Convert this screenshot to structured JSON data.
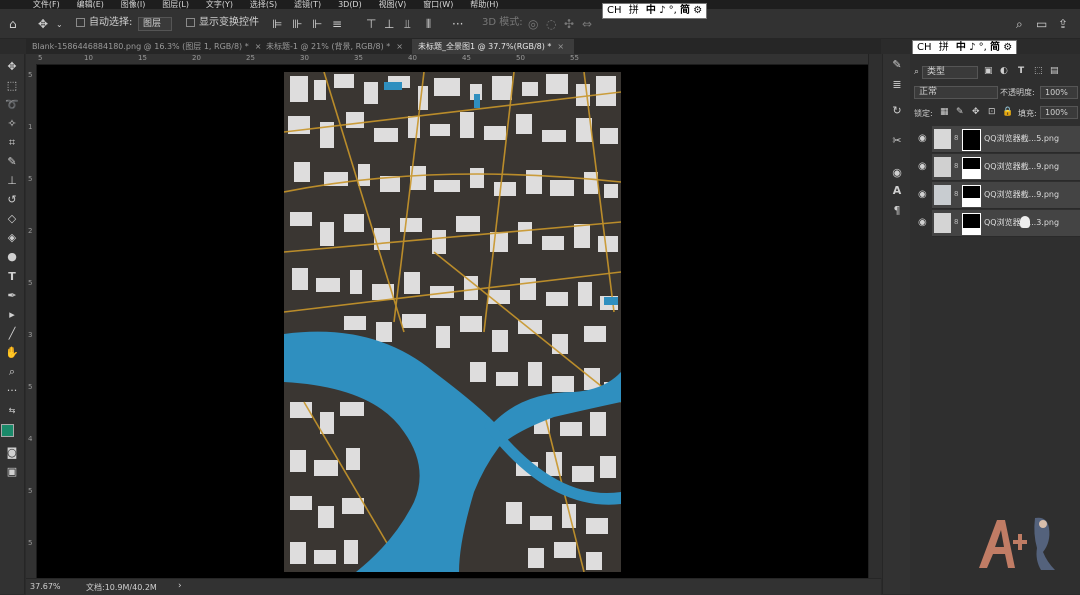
{
  "menu": [
    "文件(F)",
    "编辑(E)",
    "图像(I)",
    "图层(L)",
    "文字(Y)",
    "选择(S)",
    "滤镜(T)",
    "3D(D)",
    "视图(V)",
    "窗口(W)",
    "帮助(H)"
  ],
  "options": {
    "auto_select_label": "自动选择:",
    "auto_select_value": "图层",
    "show_transform_label": "显示变换控件",
    "mode_3d_label": "3D 模式:"
  },
  "ime": {
    "lang": "CH",
    "items": [
      "拼",
      "中",
      "♪",
      "°,",
      "简",
      "⚙"
    ]
  },
  "tabs": [
    {
      "label": "Blank-1586446884180.png @ 16.3% (图层 1, RGB/8) *",
      "active": false
    },
    {
      "label": "未标题-1 @ 21% (背景, RGB/8) *",
      "active": false
    },
    {
      "label": "未标题_全景图1 @ 37.7%(RGB/8) *",
      "active": true
    }
  ],
  "ruler_h": [
    "5",
    "10",
    "15",
    "20",
    "25",
    "30",
    "35",
    "40",
    "45",
    "50",
    "55"
  ],
  "ruler_v": [
    "5",
    "1",
    "5",
    "2",
    "5",
    "3",
    "5",
    "4",
    "5",
    "5"
  ],
  "status": {
    "zoom": "37.67%",
    "doc": "文档:10.9M/40.2M"
  },
  "layers_panel": {
    "kind_label": "类型",
    "blend_mode": "正常",
    "opacity_label": "不透明度:",
    "opacity_value": "100%",
    "lock_label": "锁定:",
    "fill_label": "填充:",
    "fill_value": "100%",
    "layers": [
      {
        "name": "QQ浏览器截...5.png"
      },
      {
        "name": "QQ浏览器截...9.png"
      },
      {
        "name": "QQ浏览器截...9.png"
      },
      {
        "name": "QQ浏览器截...3.png"
      }
    ]
  },
  "colors": {
    "water": "#2f8fbf",
    "land": "#3a3632",
    "roads": "#c8962a",
    "buildings": "#ececec",
    "fg_swatch": "#1a8a6a"
  }
}
